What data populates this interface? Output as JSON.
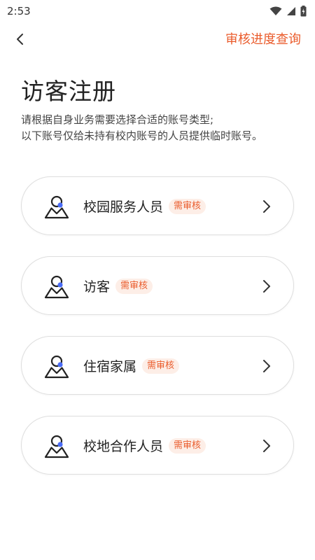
{
  "status": {
    "time": "2:53"
  },
  "nav": {
    "progress_link": "审核进度查询"
  },
  "page": {
    "title": "访客注册",
    "desc_line1": "请根据自身业务需要选择合适的账号类型;",
    "desc_line2": "以下账号仅给未持有校内账号的人员提供临时账号。"
  },
  "cards": [
    {
      "label": "校园服务人员",
      "badge": "需审核"
    },
    {
      "label": "访客",
      "badge": "需审核"
    },
    {
      "label": "住宿家属",
      "badge": "需审核"
    },
    {
      "label": "校地合作人员",
      "badge": "需审核"
    }
  ],
  "colors": {
    "accent": "#ea5b2b",
    "icon_blue": "#4a6cf7"
  },
  "icons": [
    "wifi-icon",
    "signal-icon",
    "battery-icon",
    "back-arrow-icon",
    "person-icon",
    "chevron-right-icon"
  ]
}
